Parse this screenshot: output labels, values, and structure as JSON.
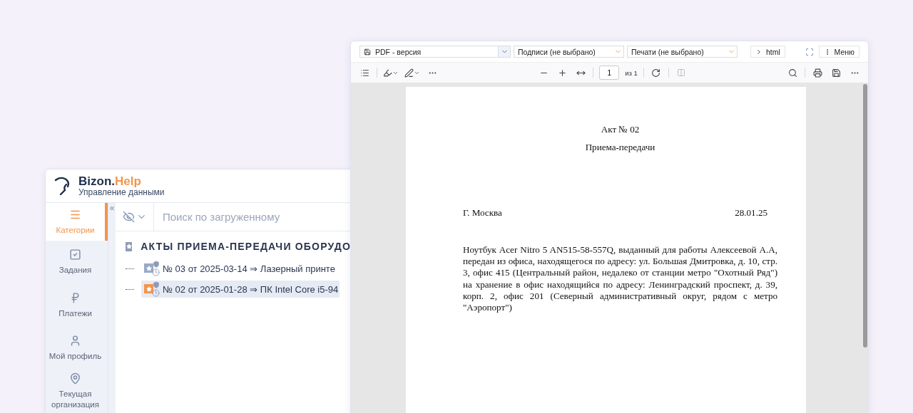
{
  "app_window": {
    "brand": {
      "name": "Bizon.",
      "accent": "Help",
      "subtitle": "Управление данными"
    },
    "sidebar": {
      "collapse": "«",
      "items": [
        {
          "label": "Категории",
          "selected": true
        },
        {
          "label": "Задания",
          "selected": false
        },
        {
          "label": "Платежи",
          "selected": false
        },
        {
          "label": "Мой профиль",
          "selected": false
        },
        {
          "label": "Текущая организация",
          "selected": false
        }
      ]
    },
    "search": {
      "placeholder": "Поиск по загруженному"
    },
    "tree": {
      "label": "АКТЫ ПРИЕМА-ПЕРЕДАЧИ ОБОРУДО",
      "children": [
        {
          "label": "№ 03 от 2025-03-14 ⇒ Лазерный принте",
          "selected": false,
          "color": "#9aa9c6"
        },
        {
          "label": "№ 02 от 2025-01-28 ⇒ ПК Intel Core i5-94",
          "selected": true,
          "color": "#f2954d"
        }
      ]
    }
  },
  "pdf_window": {
    "selects": [
      {
        "label": "PDF - версия",
        "kind": "version"
      },
      {
        "label": "Подписи (не выбрано)",
        "kind": "option"
      },
      {
        "label": "Печати (не выбрано)",
        "kind": "option"
      }
    ],
    "html_button": "html",
    "menu_button": "Меню",
    "page_input": "1",
    "page_total": "из 1",
    "document": {
      "title": "Акт № 02",
      "subtitle": "Приема-передачи",
      "city": "Г. Москва",
      "date": "28.01.25",
      "paragraph": "Ноутбук Acer Nitro 5 AN515-58-557Q, выданный для работы Алексеевой А.А, передан из офиса, находящегося по адресу: ул. Большая Дмитровка, д. 10, стр. 3, офис 415 (Центральный район, недалеко от станции метро \"Охотный Ряд\") на хранение в офис находящийся по адресу: Ленинградский проспект, д. 39, корп. 2, офис 201 (Северный административный округ, рядом с метро \"Аэропорт\")"
    }
  }
}
